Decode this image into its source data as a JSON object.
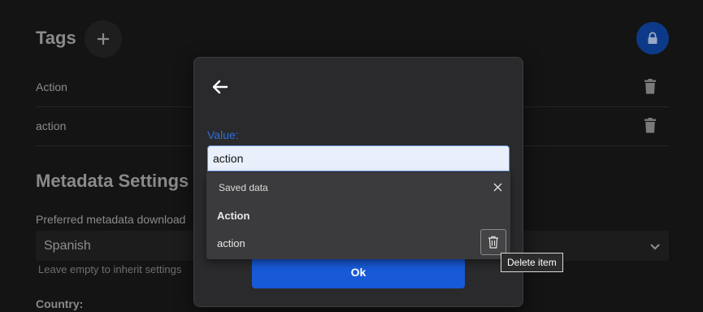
{
  "background": {
    "tags_title": "Tags",
    "tags": [
      {
        "label": "Action"
      },
      {
        "label": "action"
      }
    ],
    "metadata_title": "Metadata Settings",
    "preferred_label": "Preferred metadata download",
    "language_value": "Spanish",
    "hint": "Leave empty to inherit settings",
    "country_label": "Country:",
    "colors": {
      "lock_button": "#0d3a88"
    }
  },
  "dialog": {
    "value_label": "Value:",
    "value_input": "action",
    "ok_label": "Ok",
    "colors": {
      "accent": "#1759d6"
    }
  },
  "autocomplete": {
    "header": "Saved data",
    "items": [
      {
        "label": "Action"
      },
      {
        "label": "action"
      }
    ]
  },
  "tooltip": "Delete item",
  "icons": {
    "add": "plus-icon",
    "lock": "lock-icon",
    "trash": "trash-icon",
    "back": "arrow-left-icon",
    "close": "close-icon",
    "chevron": "chevron-down-icon"
  }
}
